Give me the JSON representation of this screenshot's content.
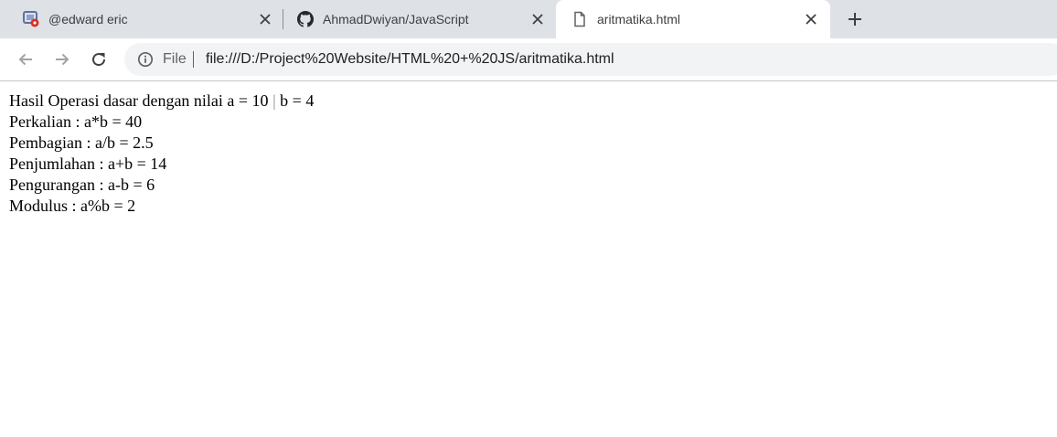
{
  "tabs": [
    {
      "title": "@edward eric",
      "icon": "youtube-studio-icon",
      "close": "×"
    },
    {
      "title": "AhmadDwiyan/JavaScript",
      "icon": "github-icon",
      "close": "×"
    },
    {
      "title": "aritmatika.html",
      "icon": "file-icon",
      "close": "×",
      "active": true
    }
  ],
  "toolbar": {
    "scheme": "File",
    "separator": "|",
    "url": "file:///D:/Project%20Website/HTML%20+%20JS/aritmatika.html"
  },
  "page": {
    "header_prefix": "Hasil Operasi dasar dengan nilai a = 10 ",
    "header_pipe": "|",
    "header_suffix": " b = 4",
    "lines": [
      "Perkalian : a*b = 40",
      "Pembagian : a/b = 2.5",
      "Penjumlahan : a+b = 14",
      "Pengurangan : a-b = 6",
      "Modulus : a%b = 2"
    ]
  },
  "colors": {
    "tabstrip": "#dee1e6",
    "omnibox": "#f1f3f4",
    "text": "#3c4043"
  }
}
